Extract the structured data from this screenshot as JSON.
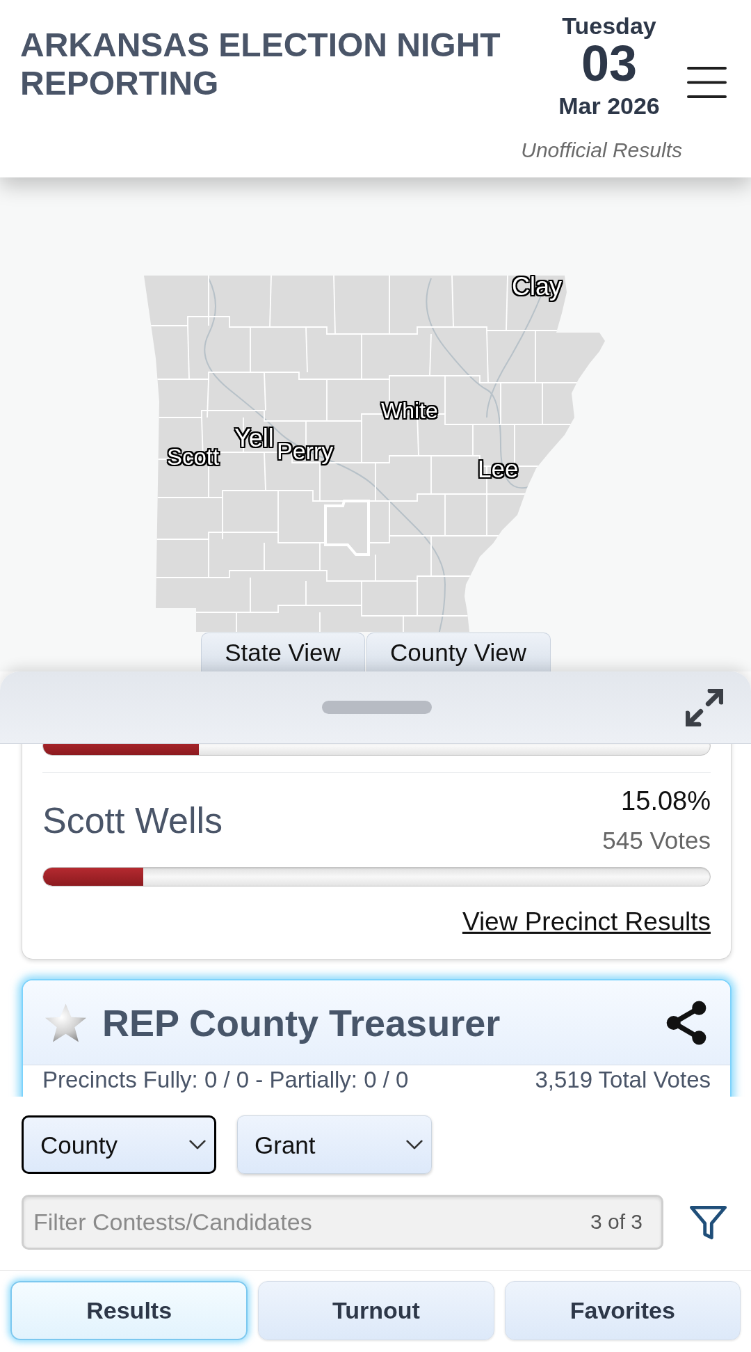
{
  "header": {
    "title": "ARKANSAS ELECTION NIGHT REPORTING",
    "date": {
      "weekday": "Tuesday",
      "day": "03",
      "month_year": "Mar 2026"
    },
    "subtitle": "Unofficial Results"
  },
  "map": {
    "county_labels": [
      {
        "text": "Clay"
      },
      {
        "text": "White"
      },
      {
        "text": "Yell"
      },
      {
        "text": "Perry"
      },
      {
        "text": "Scott"
      },
      {
        "text": "Lee"
      }
    ],
    "view_buttons": [
      {
        "label": "State View"
      },
      {
        "label": "County View"
      }
    ]
  },
  "results": {
    "previous_bar": {
      "level": 0.234
    },
    "candidates": [
      {
        "name": "Scott Wells",
        "percent": "15.08%",
        "votes": "545 Votes",
        "level": 0.15
      }
    ],
    "link": "View Precinct Results"
  },
  "contest": {
    "title": "REP County Treasurer",
    "favorite": false,
    "precincts": "Precincts Fully: 0 / 0 - Partially: 0 / 0",
    "total_votes": "3,519 Total Votes"
  },
  "filters": {
    "selects": [
      {
        "value": "County",
        "focused": true
      },
      {
        "value": "Grant",
        "focused": false
      }
    ],
    "search": {
      "placeholder": "Filter Contests/Candidates",
      "count": "3 of 3"
    }
  },
  "tabs": [
    {
      "label": "Results",
      "selected": true
    },
    {
      "label": "Turnout",
      "selected": false
    },
    {
      "label": "Favorites",
      "selected": false
    }
  ]
}
